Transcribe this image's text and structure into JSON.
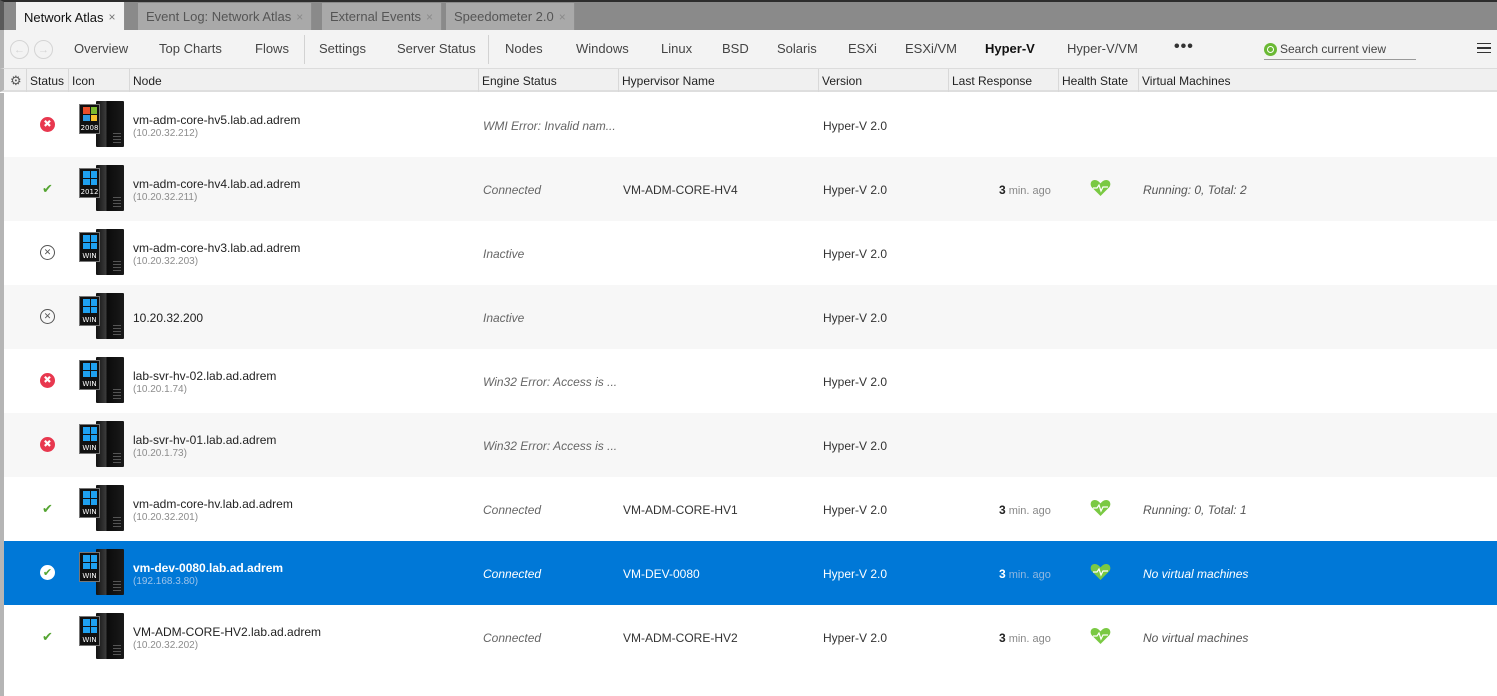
{
  "tabs": [
    {
      "label": "Network Atlas",
      "active": true
    },
    {
      "label": "Event Log: Network Atlas",
      "active": false
    },
    {
      "label": "External Events",
      "active": false
    },
    {
      "label": "Speedometer 2.0",
      "active": false
    }
  ],
  "tab_close_glyph": "×",
  "nav": {
    "back_glyph": "←",
    "forward_glyph": "→",
    "links": [
      {
        "label": "Overview"
      },
      {
        "label": "Top Charts"
      },
      {
        "label": "Flows"
      },
      {
        "label": "Settings"
      },
      {
        "label": "Server Status"
      },
      {
        "label": "Nodes"
      },
      {
        "label": "Windows"
      },
      {
        "label": "Linux"
      },
      {
        "label": "BSD"
      },
      {
        "label": "Solaris"
      },
      {
        "label": "ESXi"
      },
      {
        "label": "ESXi/VM"
      },
      {
        "label": "Hyper-V",
        "active": true
      },
      {
        "label": "Hyper-V/VM"
      }
    ],
    "more_glyph": "•••",
    "search_placeholder": "Search current view"
  },
  "columns": [
    "Status",
    "Icon",
    "Node",
    "Engine Status",
    "Hypervisor Name",
    "Version",
    "Last Response",
    "Health State",
    "Virtual Machines"
  ],
  "settings_glyph": "⚙",
  "rows": [
    {
      "status": "error",
      "os": "2008",
      "node": "vm-adm-core-hv5.lab.ad.adrem",
      "ip": "(10.20.32.212)",
      "engine": "WMI Error: Invalid nam...",
      "hypervisor": "",
      "version": "Hyper-V 2.0",
      "last_num": "",
      "last_unit": "",
      "health": false,
      "vms": ""
    },
    {
      "status": "ok",
      "os": "2012",
      "node": "vm-adm-core-hv4.lab.ad.adrem",
      "ip": "(10.20.32.211)",
      "engine": "Connected",
      "hypervisor": "VM-ADM-CORE-HV4",
      "version": "Hyper-V 2.0",
      "last_num": "3",
      "last_unit": "min. ago",
      "health": true,
      "vms": "Running: 0, Total: 2"
    },
    {
      "status": "inactive",
      "os": "WIN",
      "node": "vm-adm-core-hv3.lab.ad.adrem",
      "ip": "(10.20.32.203)",
      "engine": "Inactive",
      "hypervisor": "",
      "version": "Hyper-V 2.0",
      "last_num": "",
      "last_unit": "",
      "health": false,
      "vms": ""
    },
    {
      "status": "inactive",
      "os": "WIN",
      "node": "10.20.32.200",
      "ip": "",
      "engine": "Inactive",
      "hypervisor": "",
      "version": "Hyper-V 2.0",
      "last_num": "",
      "last_unit": "",
      "health": false,
      "vms": ""
    },
    {
      "status": "error",
      "os": "WIN",
      "node": "lab-svr-hv-02.lab.ad.adrem",
      "ip": "(10.20.1.74)",
      "engine": "Win32 Error: Access is ...",
      "hypervisor": "",
      "version": "Hyper-V 2.0",
      "last_num": "",
      "last_unit": "",
      "health": false,
      "vms": ""
    },
    {
      "status": "error",
      "os": "WIN",
      "node": "lab-svr-hv-01.lab.ad.adrem",
      "ip": "(10.20.1.73)",
      "engine": "Win32 Error: Access is ...",
      "hypervisor": "",
      "version": "Hyper-V 2.0",
      "last_num": "",
      "last_unit": "",
      "health": false,
      "vms": ""
    },
    {
      "status": "ok",
      "os": "WIN",
      "node": "vm-adm-core-hv.lab.ad.adrem",
      "ip": "(10.20.32.201)",
      "engine": "Connected",
      "hypervisor": "VM-ADM-CORE-HV1",
      "version": "Hyper-V 2.0",
      "last_num": "3",
      "last_unit": "min. ago",
      "health": true,
      "vms": "Running: 0, Total: 1"
    },
    {
      "status": "ok",
      "os": "WIN",
      "node": "vm-dev-0080.lab.ad.adrem",
      "ip": "(192.168.3.80)",
      "engine": "Connected",
      "hypervisor": "VM-DEV-0080",
      "version": "Hyper-V 2.0",
      "last_num": "3",
      "last_unit": "min. ago",
      "health": true,
      "vms": "No virtual machines",
      "selected": true
    },
    {
      "status": "ok",
      "os": "WIN",
      "node": "VM-ADM-CORE-HV2.lab.ad.adrem",
      "ip": "(10.20.32.202)",
      "engine": "Connected",
      "hypervisor": "VM-ADM-CORE-HV2",
      "version": "Hyper-V 2.0",
      "last_num": "3",
      "last_unit": "min. ago",
      "health": true,
      "vms": "No virtual machines"
    }
  ],
  "colors": {
    "selection": "#0078d7",
    "error": "#e8384f",
    "ok": "#55a532",
    "health": "#7ac943",
    "search_accent": "#6ab934"
  }
}
